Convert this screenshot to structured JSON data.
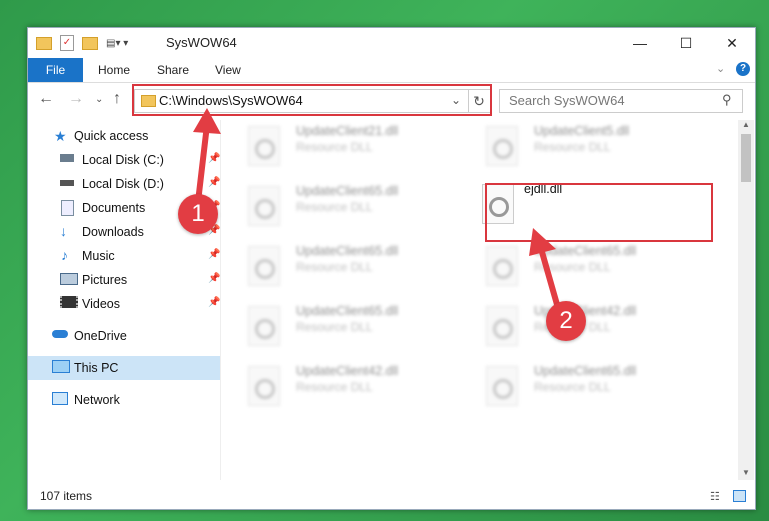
{
  "window": {
    "title": "SysWOW64"
  },
  "ribbon": {
    "file": "File",
    "tabs": [
      "Home",
      "Share",
      "View"
    ]
  },
  "address": {
    "path": "C:\\Windows\\SysWOW64"
  },
  "search": {
    "placeholder": "Search SysWOW64"
  },
  "sidebar": {
    "items": [
      {
        "label": "Quick access"
      },
      {
        "label": "Local Disk (C:)"
      },
      {
        "label": "Local Disk (D:)"
      },
      {
        "label": "Documents"
      },
      {
        "label": "Downloads"
      },
      {
        "label": "Music"
      },
      {
        "label": "Pictures"
      },
      {
        "label": "Videos"
      },
      {
        "label": "OneDrive"
      },
      {
        "label": "This PC"
      },
      {
        "label": "Network"
      }
    ]
  },
  "files": [
    {
      "name": "UpdateClient21.dll",
      "desc": "Resource DLL"
    },
    {
      "name": "UpdateClient5.dll",
      "desc": "Resource DLL"
    },
    {
      "name": "UpdateClient65.dll",
      "desc": "Resource DLL"
    },
    {
      "name": "ejdll.dll",
      "desc": ""
    },
    {
      "name": "UpdateClient65.dll",
      "desc": "Resource DLL"
    },
    {
      "name": "UpdateClient65.dll",
      "desc": "Resource DLL"
    },
    {
      "name": "UpdateClient65.dll",
      "desc": "Resource DLL"
    },
    {
      "name": "UpdateClient42.dll",
      "desc": "Resource DLL"
    },
    {
      "name": "UpdateClient42.dll",
      "desc": "Resource DLL"
    },
    {
      "name": "UpdateClient65.dll",
      "desc": "Resource DLL"
    }
  ],
  "status": {
    "count": "107 items"
  },
  "annotations": {
    "step1": "1",
    "step2": "2"
  },
  "colors": {
    "accent": "#1a73c8",
    "highlight": "#d9363e",
    "selected": "#cce4f7"
  }
}
